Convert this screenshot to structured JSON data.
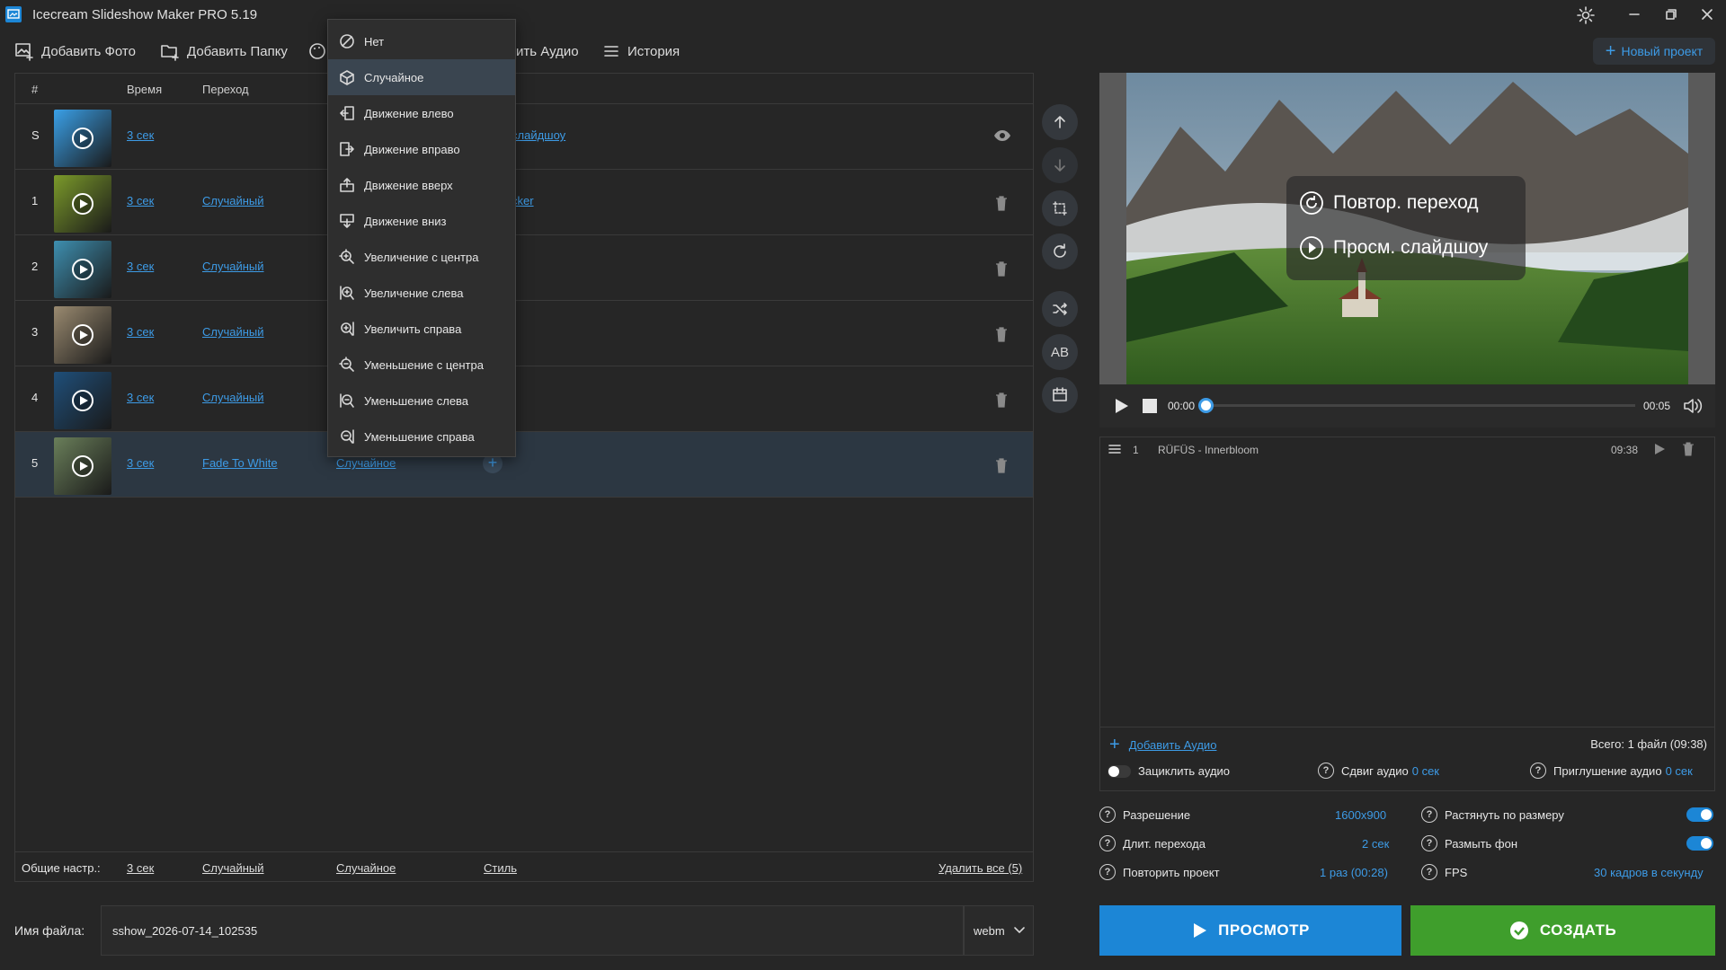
{
  "app": {
    "title": "Icecream Slideshow Maker PRO 5.19"
  },
  "toolbar": {
    "add_photo": "Добавить Фото",
    "add_folder": "Добавить Папку",
    "add_audio": "ить Аудио",
    "history": "История",
    "new_project": "Новый проект"
  },
  "table": {
    "headers": {
      "num": "#",
      "time": "Время",
      "transition": "Переход"
    },
    "rows": [
      {
        "num": "S",
        "time": "3 сек",
        "transition": "",
        "extra": "слайдшоу",
        "thumb_color": "#3aa0e8",
        "action": "eye"
      },
      {
        "num": "1",
        "time": "3 сек",
        "transition": "Случайный",
        "extra": "cker",
        "thumb_color": "#7b9a2a",
        "action": "trash"
      },
      {
        "num": "2",
        "time": "3 сек",
        "transition": "Случайный",
        "extra": "",
        "thumb_color": "#3e8fb0",
        "action": "trash"
      },
      {
        "num": "3",
        "time": "3 сек",
        "transition": "Случайный",
        "extra": "",
        "thumb_color": "#9a8a70",
        "action": "trash"
      },
      {
        "num": "4",
        "time": "3 сек",
        "transition": "Случайный",
        "extra": "",
        "thumb_color": "#1f4f7a",
        "action": "trash"
      },
      {
        "num": "5",
        "time": "3 сек",
        "transition": "Fade To White",
        "extra": "Случайное",
        "thumb_color": "#6a7f5a",
        "action": "trash"
      }
    ],
    "footer": {
      "label": "Общие настр.:",
      "time": "3 сек",
      "transition": "Случайный",
      "effect": "Случайное",
      "style": "Стиль",
      "delete_all": "Удалить все (5)"
    }
  },
  "dropdown": {
    "items": [
      {
        "label": "Нет",
        "icon": "none-icon"
      },
      {
        "label": "Случайное",
        "icon": "random-cube-icon"
      },
      {
        "label": "Движение влево",
        "icon": "move-left-icon"
      },
      {
        "label": "Движение вправо",
        "icon": "move-right-icon"
      },
      {
        "label": "Движение вверх",
        "icon": "move-up-icon"
      },
      {
        "label": "Движение вниз",
        "icon": "move-down-icon"
      },
      {
        "label": "Увеличение с центра",
        "icon": "zoom-in-center-icon"
      },
      {
        "label": "Увеличение слева",
        "icon": "zoom-in-left-icon"
      },
      {
        "label": "Увеличить справа",
        "icon": "zoom-in-right-icon"
      },
      {
        "label": "Уменьшение с центра",
        "icon": "zoom-out-center-icon"
      },
      {
        "label": "Уменьшение слева",
        "icon": "zoom-out-left-icon"
      },
      {
        "label": "Уменьшение справа",
        "icon": "zoom-out-right-icon"
      }
    ],
    "active_index": 1
  },
  "preview": {
    "repeat_transition": "Повтор. переход",
    "view_slideshow": "Просм. слайдшоу",
    "time_current": "00:00",
    "time_total": "00:05",
    "progress": 0
  },
  "audio": {
    "tracks": [
      {
        "num": "1",
        "title": "RÜFÜS - Innerbloom",
        "duration": "09:38"
      }
    ],
    "add_audio": "Добавить Аудио",
    "total": "Всего: 1 файл (09:38)",
    "loop_label": "Зациклить аудио",
    "loop_on": false,
    "shift_label": "Сдвиг аудио",
    "shift_value": "0 сек",
    "fade_label": "Приглушение аудио",
    "fade_value": "0 сек"
  },
  "settings": {
    "resolution_label": "Разрешение",
    "resolution_value": "1600x900",
    "transition_dur_label": "Длит. перехода",
    "transition_dur_value": "2 сек",
    "repeat_label": "Повторить проект",
    "repeat_value": "1 раз (00:28)",
    "stretch_label": "Растянуть по размеру",
    "stretch_on": true,
    "blur_label": "Размыть фон",
    "blur_on": true,
    "fps_label": "FPS",
    "fps_value": "30 кадров в секунду"
  },
  "output": {
    "filename_label": "Имя файла:",
    "filename_value": "sshow_2026-07-14_102535",
    "format": "webm",
    "preview_button": "ПРОСМОТР",
    "create_button": "СОЗДАТЬ"
  },
  "colors": {
    "accent": "#3d9be6",
    "preview_btn": "#1c86d6",
    "create_btn": "#3f9e2c",
    "selected_row": "#2c3742"
  }
}
